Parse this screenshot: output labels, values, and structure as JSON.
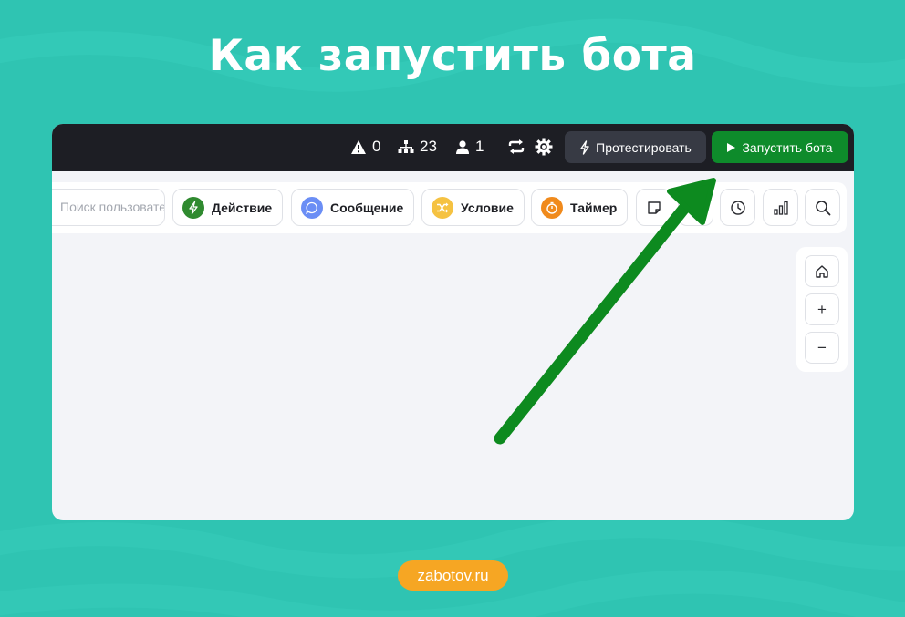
{
  "title": "Как запустить бота",
  "topbar": {
    "warnings_count": "0",
    "nodes_count": "23",
    "users_count": "1",
    "test_label": "Протестировать",
    "launch_label": "Запустить бота"
  },
  "toolbar": {
    "search_placeholder": "Поиск пользователя",
    "items": [
      {
        "label": "Действие",
        "icon": "lightning-icon",
        "color": "#2f8a2f"
      },
      {
        "label": "Сообщение",
        "icon": "chat-bubble-icon",
        "color": "#6b8ef5"
      },
      {
        "label": "Условие",
        "icon": "shuffle-icon",
        "color": "#f5c242"
      },
      {
        "label": "Таймер",
        "icon": "timer-icon",
        "color": "#f08a1c"
      }
    ]
  },
  "zoom": {
    "plus": "+",
    "minus": "−"
  },
  "footer": {
    "site": "zabotov.ru"
  },
  "colors": {
    "background": "#2fc4b2",
    "topbar": "#1d1e24",
    "launch_button": "#0e8b2b",
    "arrow": "#0d8a1f",
    "badge": "#f6a623"
  }
}
